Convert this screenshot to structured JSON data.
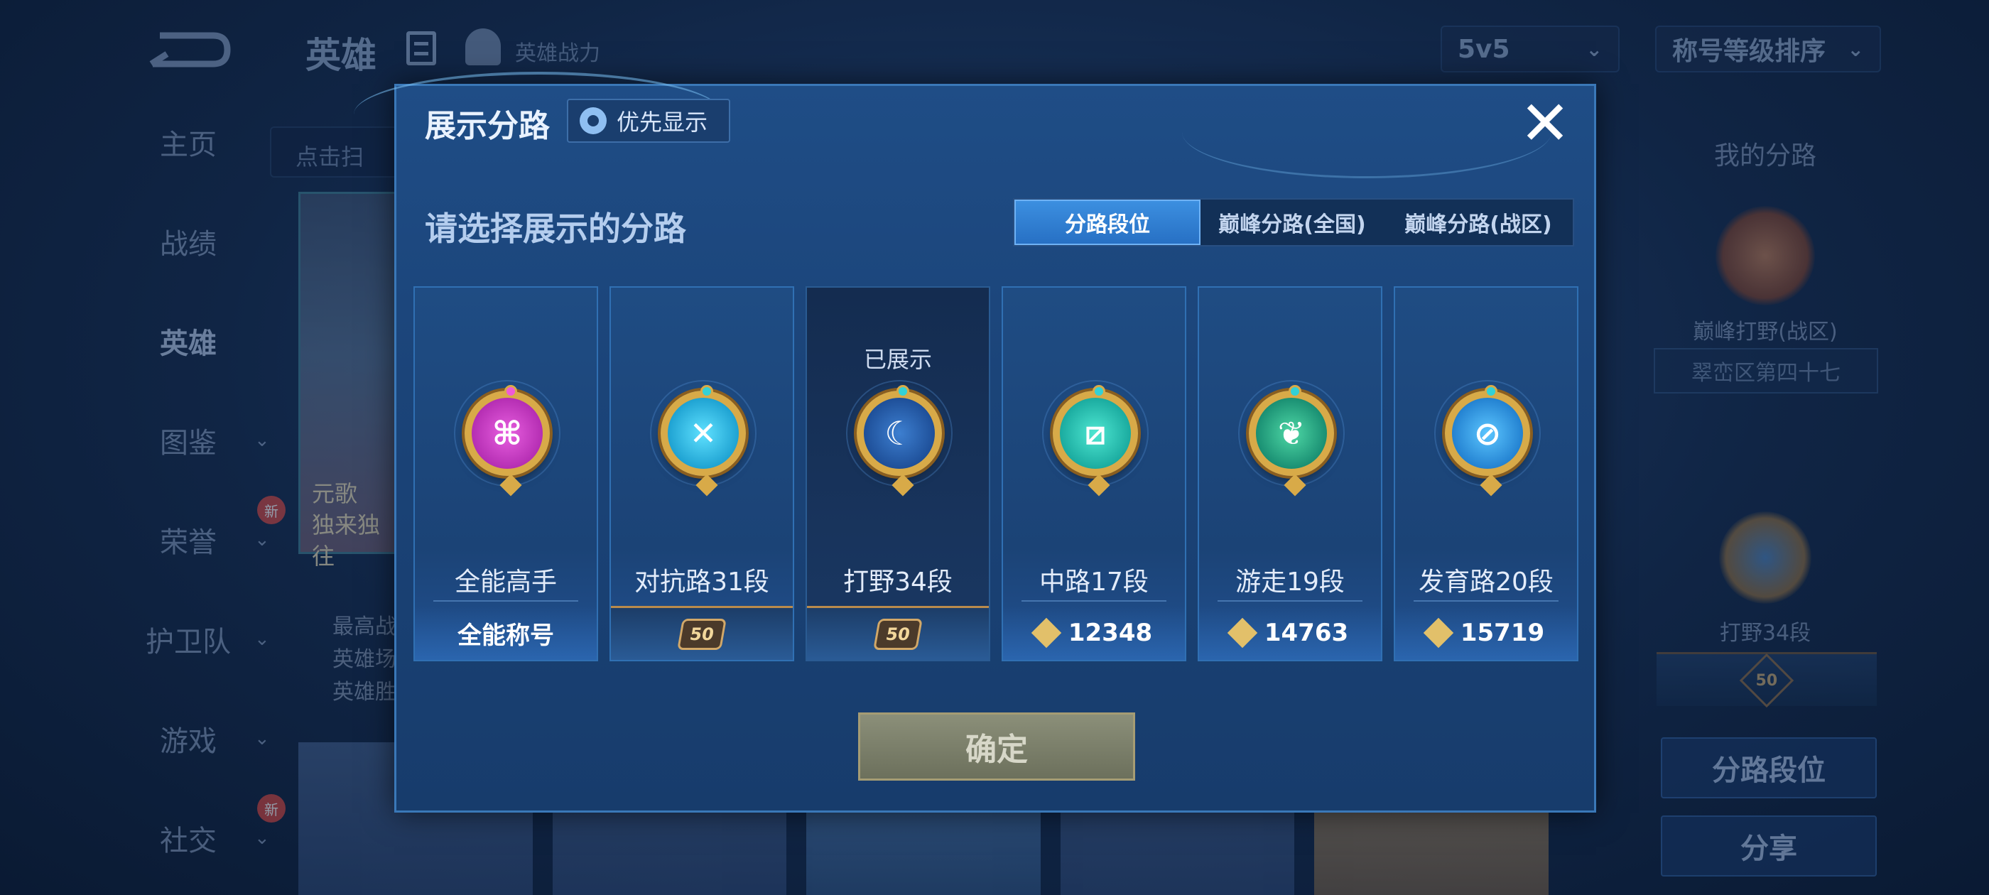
{
  "top_bar": {
    "title": "英雄",
    "subtitle": "英雄战力",
    "mode_dropdown": "5v5",
    "sort_dropdown": "称号等级排序"
  },
  "side_nav": {
    "items": [
      {
        "label": "主页",
        "has_chevron": false,
        "badge": ""
      },
      {
        "label": "战绩",
        "has_chevron": false,
        "badge": ""
      },
      {
        "label": "英雄",
        "has_chevron": false,
        "badge": "",
        "active": true
      },
      {
        "label": "图鉴",
        "has_chevron": true,
        "badge": ""
      },
      {
        "label": "荣誉",
        "has_chevron": true,
        "badge": "新"
      },
      {
        "label": "护卫队",
        "has_chevron": true,
        "badge": ""
      },
      {
        "label": "游戏",
        "has_chevron": true,
        "badge": ""
      },
      {
        "label": "社交",
        "has_chevron": true,
        "badge": "新"
      }
    ]
  },
  "background": {
    "search_stub": "点击扫",
    "hero_name_line1": "元歌",
    "hero_name_line2": "独来独往",
    "info_lines": [
      "最高战",
      "英雄场",
      "英雄胜"
    ]
  },
  "right_panel": {
    "title": "我的分路",
    "peak_caption": "巅峰打野(战区)",
    "region_text": "翠峦区第四十七",
    "lane_caption": "打野34段",
    "plate_stars": "50",
    "button_lane_rank": "分路段位",
    "button_share": "分享"
  },
  "modal": {
    "title": "展示分路",
    "priority_label": "优先显示",
    "close_symbol": "✕",
    "prompt": "请选择展示的分路",
    "tabs": [
      {
        "label": "分路段位",
        "active": true
      },
      {
        "label": "巅峰分路(全国)",
        "active": false
      },
      {
        "label": "巅峰分路(战区)",
        "active": false
      }
    ],
    "cards": [
      {
        "id": "allround",
        "rank": "全能高手",
        "bottom_text": "全能称号",
        "bottom_type": "text",
        "shown": "",
        "icon": "allround-emblem-icon"
      },
      {
        "id": "clash",
        "rank": "对抗路31段",
        "bottom_text": "50",
        "bottom_type": "stars",
        "shown": "",
        "icon": "clash-lane-emblem-icon"
      },
      {
        "id": "jungle",
        "rank": "打野34段",
        "bottom_text": "50",
        "bottom_type": "stars",
        "shown": "已展示",
        "icon": "jungle-emblem-icon"
      },
      {
        "id": "mid",
        "rank": "中路17段",
        "bottom_text": "12348",
        "bottom_type": "score",
        "shown": "",
        "icon": "mid-lane-emblem-icon"
      },
      {
        "id": "roam",
        "rank": "游走19段",
        "bottom_text": "14763",
        "bottom_type": "score",
        "shown": "",
        "icon": "roam-emblem-icon"
      },
      {
        "id": "farm",
        "rank": "发育路20段",
        "bottom_text": "15719",
        "bottom_type": "score",
        "shown": "",
        "icon": "farm-lane-emblem-icon"
      }
    ],
    "confirm_label": "确定"
  },
  "colors": {
    "modal_bg": "#1f4d86",
    "tab_active": "#2f7fd6",
    "gold": "#d8aa48",
    "confirm_disabled": "#7c806a"
  }
}
